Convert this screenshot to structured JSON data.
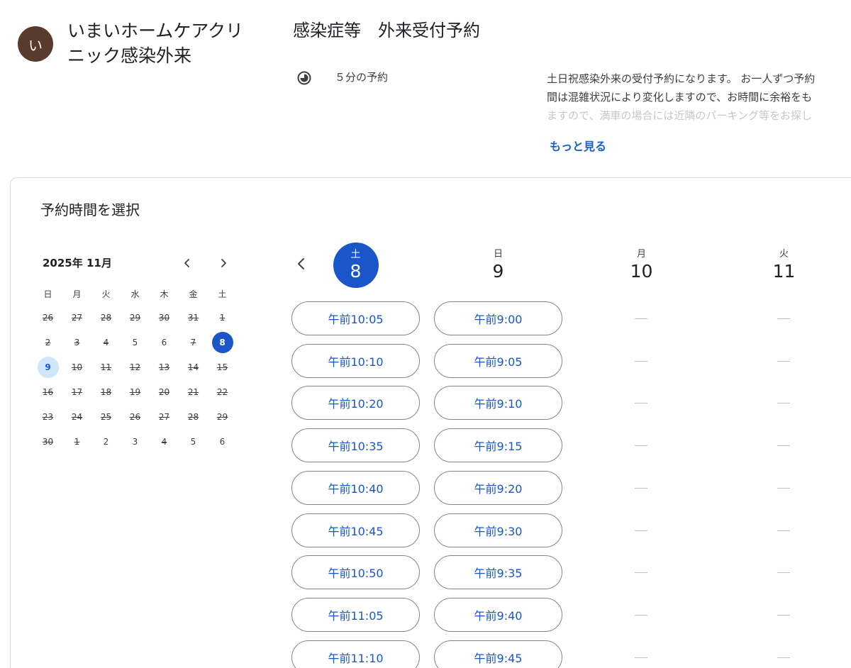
{
  "header": {
    "avatar_letter": "い",
    "org_name": "いまいホームケアクリニック感染外来",
    "page_title": "感染症等　外来受付予約",
    "duration": "５分の予約",
    "description_lines": [
      "土日祝感染外来の受付予約になります。 お一人ずつ予約",
      "間は混雑状況により変化しますので、お時間に余裕をも",
      "ますので、満車の場合には近隣のパーキング等をお探し"
    ],
    "more_link": "もっと見る"
  },
  "booking": {
    "card_title": "予約時間を選択",
    "calendar": {
      "month_label": "2025年 11月",
      "prev_icon": "chevron-left-icon",
      "next_icon": "chevron-right-icon",
      "weekday_headers": [
        "日",
        "月",
        "火",
        "水",
        "木",
        "金",
        "土"
      ],
      "weeks": [
        [
          {
            "d": "26",
            "s": "off"
          },
          {
            "d": "27",
            "s": "off"
          },
          {
            "d": "28",
            "s": "off"
          },
          {
            "d": "29",
            "s": "off"
          },
          {
            "d": "30",
            "s": "off"
          },
          {
            "d": "31",
            "s": "off"
          },
          {
            "d": "1",
            "s": "off"
          }
        ],
        [
          {
            "d": "2",
            "s": "off"
          },
          {
            "d": "3",
            "s": "off"
          },
          {
            "d": "4",
            "s": "off"
          },
          {
            "d": "5",
            "s": "plain"
          },
          {
            "d": "6",
            "s": "plain"
          },
          {
            "d": "7",
            "s": "off"
          },
          {
            "d": "8",
            "s": "selected"
          }
        ],
        [
          {
            "d": "9",
            "s": "avail"
          },
          {
            "d": "10",
            "s": "off"
          },
          {
            "d": "11",
            "s": "off"
          },
          {
            "d": "12",
            "s": "off"
          },
          {
            "d": "13",
            "s": "off"
          },
          {
            "d": "14",
            "s": "off"
          },
          {
            "d": "15",
            "s": "off"
          }
        ],
        [
          {
            "d": "16",
            "s": "off"
          },
          {
            "d": "17",
            "s": "off"
          },
          {
            "d": "18",
            "s": "off"
          },
          {
            "d": "19",
            "s": "off"
          },
          {
            "d": "20",
            "s": "off"
          },
          {
            "d": "21",
            "s": "off"
          },
          {
            "d": "22",
            "s": "off"
          }
        ],
        [
          {
            "d": "23",
            "s": "off"
          },
          {
            "d": "24",
            "s": "off"
          },
          {
            "d": "25",
            "s": "off"
          },
          {
            "d": "26",
            "s": "off"
          },
          {
            "d": "27",
            "s": "off"
          },
          {
            "d": "28",
            "s": "off"
          },
          {
            "d": "29",
            "s": "off"
          }
        ],
        [
          {
            "d": "30",
            "s": "off"
          },
          {
            "d": "1",
            "s": "off"
          },
          {
            "d": "2",
            "s": "plain"
          },
          {
            "d": "3",
            "s": "plain"
          },
          {
            "d": "4",
            "s": "off"
          },
          {
            "d": "5",
            "s": "plain"
          },
          {
            "d": "6",
            "s": "plain"
          }
        ]
      ]
    },
    "week_prev_icon": "chevron-left-icon",
    "days": [
      {
        "dow": "土",
        "num": "8",
        "active": true,
        "slots": [
          "午前10:05",
          "午前10:10",
          "午前10:20",
          "午前10:35",
          "午前10:40",
          "午前10:45",
          "午前10:50",
          "午前11:05",
          "午前11:10"
        ]
      },
      {
        "dow": "日",
        "num": "9",
        "active": false,
        "slots": [
          "午前9:00",
          "午前9:05",
          "午前9:10",
          "午前9:15",
          "午前9:20",
          "午前9:30",
          "午前9:35",
          "午前9:40",
          "午前9:45"
        ]
      },
      {
        "dow": "月",
        "num": "10",
        "active": false,
        "slots": []
      },
      {
        "dow": "火",
        "num": "11",
        "active": false,
        "slots": []
      }
    ]
  },
  "colors": {
    "accent": "#1a56c9",
    "avatar": "#5b3a2e",
    "available_day": "#cfe5fb"
  }
}
